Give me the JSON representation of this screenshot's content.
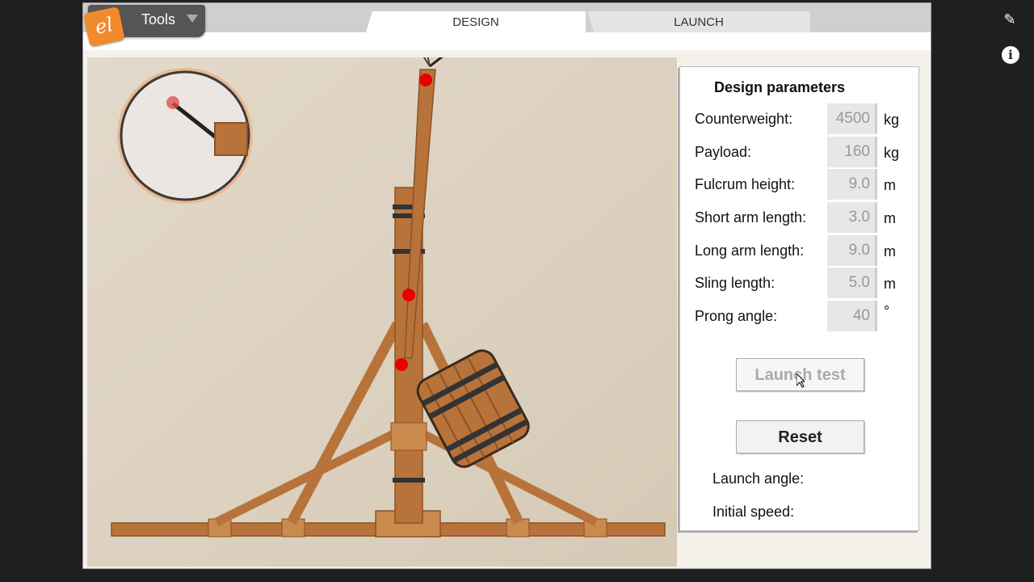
{
  "header": {
    "logo_text": "el",
    "tools_label": "Tools",
    "tabs": [
      {
        "label": "DESIGN",
        "active": true
      },
      {
        "label": "LAUNCH",
        "active": false
      }
    ]
  },
  "panel": {
    "title": "Design parameters",
    "params": [
      {
        "label": "Counterweight:",
        "value": "4500",
        "unit": "kg"
      },
      {
        "label": "Payload:",
        "value": "160",
        "unit": "kg"
      },
      {
        "label": "Fulcrum height:",
        "value": "9.0",
        "unit": "m"
      },
      {
        "label": "Short arm length:",
        "value": "3.0",
        "unit": "m"
      },
      {
        "label": "Long arm length:",
        "value": "9.0",
        "unit": "m"
      },
      {
        "label": "Sling length:",
        "value": "5.0",
        "unit": "m"
      },
      {
        "label": "Prong angle:",
        "value": "40",
        "unit": "°"
      }
    ],
    "launch_test_label": "Launch test",
    "reset_label": "Reset",
    "launch_angle_label": "Launch angle:",
    "initial_speed_label": "Initial speed:"
  },
  "sidebar": {
    "pin_icon": "pin-icon",
    "info_icon": "info-icon"
  },
  "colors": {
    "wood": "#b8733a",
    "wood_dark": "#8b5228",
    "marker": "#e80000",
    "accent": "#f28a2c"
  }
}
